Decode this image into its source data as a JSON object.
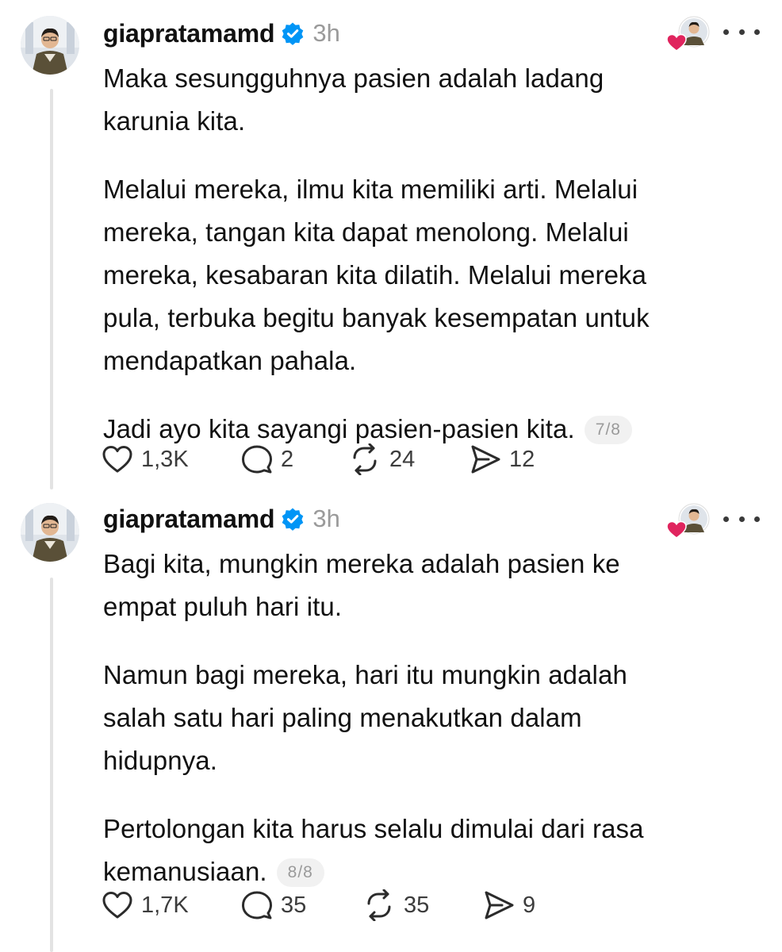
{
  "posts": [
    {
      "username": "giapratamamd",
      "time": "3h",
      "paragraphs": [
        "Maka sesungguhnya pasien adalah ladang\nkarunia kita.",
        "Melalui mereka, ilmu kita memiliki arti. Melalui\nmereka, tangan kita dapat menolong. Melalui\nmereka, kesabaran kita dilatih. Melalui mereka\npula, terbuka begitu banyak kesempatan untuk\nmendapatkan pahala.",
        "Jadi ayo kita sayangi pasien-pasien kita."
      ],
      "page_counter": "7/8",
      "likes": "1,3K",
      "replies": "2",
      "reposts": "24",
      "shares": "12",
      "like_icon": "heart-outline-icon",
      "reply_icon": "speech-bubble-icon",
      "repost_icon": "repost-arrows-icon",
      "share_icon": "send-paper-plane-icon"
    },
    {
      "username": "giapratamamd",
      "time": "3h",
      "paragraphs": [
        "Bagi kita, mungkin mereka adalah pasien ke\nempat puluh hari itu.",
        "Namun bagi mereka, hari itu mungkin adalah\nsalah satu hari paling menakutkan dalam\nhidupnya.",
        "Pertolongan kita harus selalu dimulai dari rasa\nkemanusiaan."
      ],
      "page_counter": "8/8",
      "likes": "1,7K",
      "replies": "35",
      "reposts": "35",
      "shares": "9",
      "like_icon": "heart-outline-icon",
      "reply_icon": "speech-bubble-icon",
      "repost_icon": "repost-arrows-icon",
      "share_icon": "send-paper-plane-icon"
    }
  ],
  "colors": {
    "verified": "#0095f6",
    "heart_badge": "#e0245e",
    "text": "#111111",
    "muted": "#9a9a9a"
  }
}
